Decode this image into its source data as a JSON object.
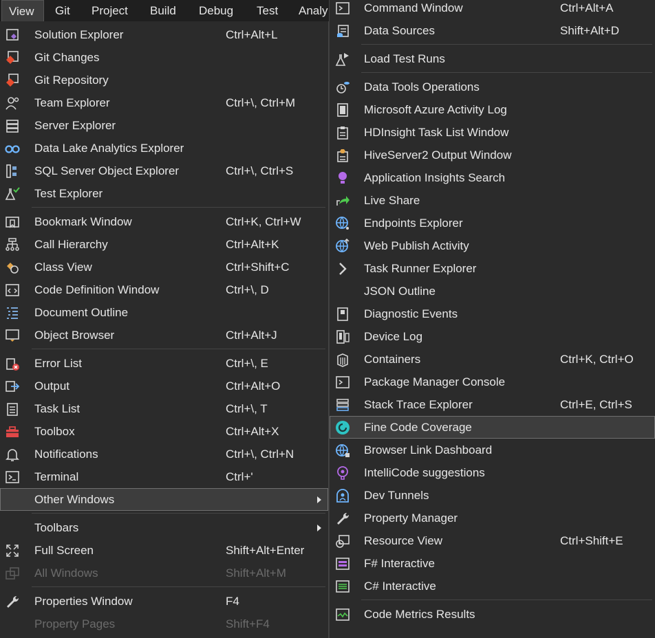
{
  "menubar": [
    "View",
    "Git",
    "Project",
    "Build",
    "Debug",
    "Test",
    "Analy"
  ],
  "left": {
    "groups": [
      [
        {
          "icon": "solution-explorer-icon",
          "label": "Solution Explorer",
          "shortcut": "Ctrl+Alt+L"
        },
        {
          "icon": "git-changes-icon",
          "label": "Git Changes",
          "shortcut": ""
        },
        {
          "icon": "git-repository-icon",
          "label": "Git Repository",
          "shortcut": ""
        },
        {
          "icon": "team-explorer-icon",
          "label": "Team Explorer",
          "shortcut": "Ctrl+\\, Ctrl+M"
        },
        {
          "icon": "server-explorer-icon",
          "label": "Server Explorer",
          "shortcut": ""
        },
        {
          "icon": "data-lake-icon",
          "label": "Data Lake Analytics Explorer",
          "shortcut": ""
        },
        {
          "icon": "sql-server-icon",
          "label": "SQL Server Object Explorer",
          "shortcut": "Ctrl+\\, Ctrl+S"
        },
        {
          "icon": "test-explorer-icon",
          "label": "Test Explorer",
          "shortcut": ""
        }
      ],
      [
        {
          "icon": "bookmark-icon",
          "label": "Bookmark Window",
          "shortcut": "Ctrl+K, Ctrl+W"
        },
        {
          "icon": "call-hierarchy-icon",
          "label": "Call Hierarchy",
          "shortcut": "Ctrl+Alt+K"
        },
        {
          "icon": "class-view-icon",
          "label": "Class View",
          "shortcut": "Ctrl+Shift+C"
        },
        {
          "icon": "code-definition-icon",
          "label": "Code Definition Window",
          "shortcut": "Ctrl+\\, D"
        },
        {
          "icon": "document-outline-icon",
          "label": "Document Outline",
          "shortcut": ""
        },
        {
          "icon": "object-browser-icon",
          "label": "Object Browser",
          "shortcut": "Ctrl+Alt+J"
        }
      ],
      [
        {
          "icon": "error-list-icon",
          "label": "Error List",
          "shortcut": "Ctrl+\\, E"
        },
        {
          "icon": "output-icon",
          "label": "Output",
          "shortcut": "Ctrl+Alt+O"
        },
        {
          "icon": "task-list-icon",
          "label": "Task List",
          "shortcut": "Ctrl+\\, T"
        },
        {
          "icon": "toolbox-icon",
          "label": "Toolbox",
          "shortcut": "Ctrl+Alt+X"
        },
        {
          "icon": "notifications-icon",
          "label": "Notifications",
          "shortcut": "Ctrl+\\, Ctrl+N"
        },
        {
          "icon": "terminal-icon",
          "label": "Terminal",
          "shortcut": "Ctrl+'"
        },
        {
          "icon": "",
          "label": "Other Windows",
          "shortcut": "",
          "submenu": true,
          "highlighted": true
        }
      ],
      [
        {
          "icon": "",
          "label": "Toolbars",
          "shortcut": "",
          "submenu": true
        },
        {
          "icon": "full-screen-icon",
          "label": "Full Screen",
          "shortcut": "Shift+Alt+Enter"
        },
        {
          "icon": "all-windows-icon",
          "label": "All Windows",
          "shortcut": "Shift+Alt+M",
          "disabled": true
        }
      ],
      [
        {
          "icon": "wrench-icon",
          "label": "Properties Window",
          "shortcut": "F4"
        },
        {
          "icon": "",
          "label": "Property Pages",
          "shortcut": "Shift+F4",
          "disabled": true
        }
      ]
    ]
  },
  "right": {
    "groups": [
      [
        {
          "icon": "command-window-icon",
          "label": "Command Window",
          "shortcut": "Ctrl+Alt+A"
        },
        {
          "icon": "data-sources-icon",
          "label": "Data Sources",
          "shortcut": "Shift+Alt+D"
        }
      ],
      [
        {
          "icon": "load-test-icon",
          "label": "Load Test Runs",
          "shortcut": ""
        }
      ],
      [
        {
          "icon": "data-tools-icon",
          "label": "Data Tools Operations",
          "shortcut": ""
        },
        {
          "icon": "azure-log-icon",
          "label": "Microsoft Azure Activity Log",
          "shortcut": ""
        },
        {
          "icon": "hdinsight-icon",
          "label": "HDInsight Task List Window",
          "shortcut": ""
        },
        {
          "icon": "hiveserver-icon",
          "label": "HiveServer2 Output Window",
          "shortcut": ""
        },
        {
          "icon": "app-insights-icon",
          "label": "Application Insights Search",
          "shortcut": ""
        },
        {
          "icon": "live-share-icon",
          "label": "Live Share",
          "shortcut": ""
        },
        {
          "icon": "endpoints-icon",
          "label": "Endpoints Explorer",
          "shortcut": ""
        },
        {
          "icon": "web-publish-icon",
          "label": "Web Publish Activity",
          "shortcut": ""
        },
        {
          "icon": "task-runner-icon",
          "label": "Task Runner Explorer",
          "shortcut": ""
        },
        {
          "icon": "",
          "label": "JSON Outline",
          "shortcut": ""
        },
        {
          "icon": "diagnostic-events-icon",
          "label": "Diagnostic Events",
          "shortcut": ""
        },
        {
          "icon": "device-log-icon",
          "label": "Device Log",
          "shortcut": ""
        },
        {
          "icon": "containers-icon",
          "label": "Containers",
          "shortcut": "Ctrl+K, Ctrl+O"
        },
        {
          "icon": "package-manager-icon",
          "label": "Package Manager Console",
          "shortcut": ""
        },
        {
          "icon": "stack-trace-icon",
          "label": "Stack Trace Explorer",
          "shortcut": "Ctrl+E, Ctrl+S"
        },
        {
          "icon": "fine-code-coverage-icon",
          "label": "Fine Code Coverage",
          "shortcut": "",
          "highlighted": true
        },
        {
          "icon": "browser-link-icon",
          "label": "Browser Link Dashboard",
          "shortcut": ""
        },
        {
          "icon": "intellicode-icon",
          "label": "IntelliCode suggestions",
          "shortcut": ""
        },
        {
          "icon": "dev-tunnels-icon",
          "label": "Dev Tunnels",
          "shortcut": ""
        },
        {
          "icon": "wrench-icon",
          "label": "Property Manager",
          "shortcut": ""
        },
        {
          "icon": "resource-view-icon",
          "label": "Resource View",
          "shortcut": "Ctrl+Shift+E"
        },
        {
          "icon": "fsharp-interactive-icon",
          "label": "F# Interactive",
          "shortcut": ""
        },
        {
          "icon": "csharp-interactive-icon",
          "label": "C# Interactive",
          "shortcut": ""
        }
      ],
      [
        {
          "icon": "code-metrics-icon",
          "label": "Code Metrics Results",
          "shortcut": ""
        }
      ]
    ]
  },
  "colors": {
    "background": "#2b2b2b",
    "menubar": "#1f1f1f",
    "text": "#e6e6e6",
    "disabled": "#6b6b6b",
    "highlight": "#3d3d3d"
  }
}
